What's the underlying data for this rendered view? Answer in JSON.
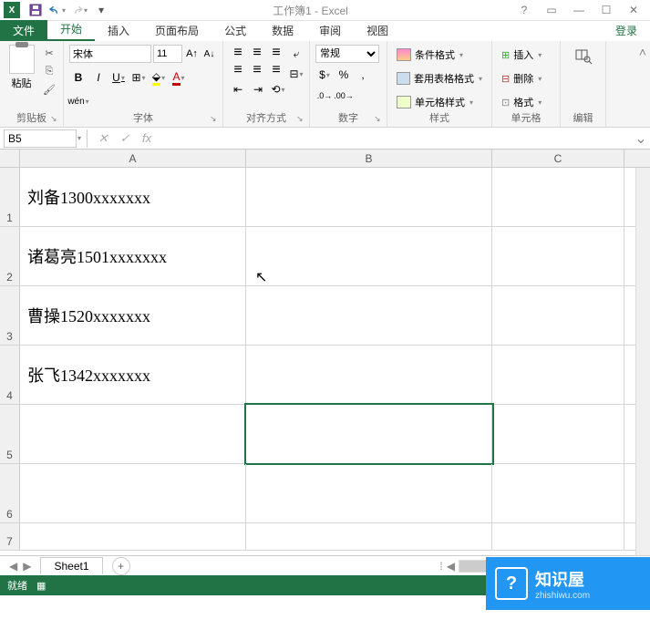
{
  "title": "工作簿1 - Excel",
  "tabs": {
    "file": "文件",
    "home": "开始",
    "insert": "插入",
    "layout": "页面布局",
    "formulas": "公式",
    "data": "数据",
    "review": "审阅",
    "view": "视图",
    "login": "登录"
  },
  "ribbon": {
    "clipboard": {
      "label": "剪贴板",
      "paste": "粘贴"
    },
    "font": {
      "label": "字体",
      "name": "宋体",
      "size": "11",
      "bold": "B",
      "italic": "I",
      "underline": "U"
    },
    "align": {
      "label": "对齐方式"
    },
    "number": {
      "label": "数字",
      "format": "常规"
    },
    "styles": {
      "label": "样式",
      "conditional": "条件格式",
      "table": "套用表格格式",
      "cell": "单元格样式"
    },
    "cells": {
      "label": "单元格",
      "insert": "插入",
      "delete": "删除",
      "format": "格式"
    },
    "editing": {
      "label": "编辑"
    }
  },
  "name_box": "B5",
  "columns": [
    "A",
    "B",
    "C"
  ],
  "rows": [
    {
      "n": "1",
      "a": "刘备1300xxxxxxx"
    },
    {
      "n": "2",
      "a": "诸葛亮1501xxxxxxx"
    },
    {
      "n": "3",
      "a": "曹操1520xxxxxxx"
    },
    {
      "n": "4",
      "a": "张飞1342xxxxxxx"
    },
    {
      "n": "5",
      "a": ""
    },
    {
      "n": "6",
      "a": ""
    },
    {
      "n": "7",
      "a": ""
    }
  ],
  "sheet": {
    "name": "Sheet1"
  },
  "status": {
    "ready": "就绪"
  },
  "watermark": {
    "main": "知识屋",
    "sub": "zhishiwu.com"
  }
}
